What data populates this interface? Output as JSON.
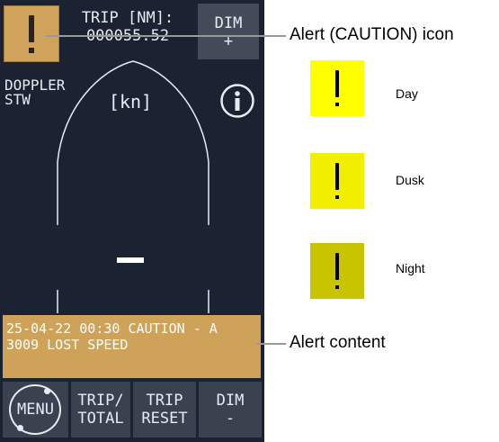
{
  "display": {
    "trip_label": "TRIP [NM]:",
    "trip_value": "000055.52",
    "dim_top_label": "DIM",
    "dim_top_sign": "+",
    "doppler_line1": "DOPPLER",
    "doppler_line2": "STW",
    "unit": "[kn]",
    "alert_line1": "25-04-22 00:30 CAUTION - A",
    "alert_line2": "3009 LOST SPEED",
    "buttons": {
      "menu": "MENU",
      "trip_line1": "TRIP/",
      "trip_line2": "TOTAL",
      "reset_line1": "TRIP",
      "reset_line2": "RESET",
      "dim_line1": "DIM",
      "dim_line2": "-"
    },
    "colors": {
      "screen_bg": "#1b2231",
      "alert_amber": "#cea258"
    }
  },
  "annotations": {
    "alert_icon_label": "Alert (CAUTION) icon",
    "alert_content_label": "Alert content"
  },
  "icon_variants": [
    {
      "label": "Day",
      "bg": "#ffff00",
      "mark": "#000000"
    },
    {
      "label": "Dusk",
      "bg": "#f2ee00",
      "mark": "#000000"
    },
    {
      "label": "Night",
      "bg": "#c8c400",
      "mark": "#000000"
    }
  ]
}
